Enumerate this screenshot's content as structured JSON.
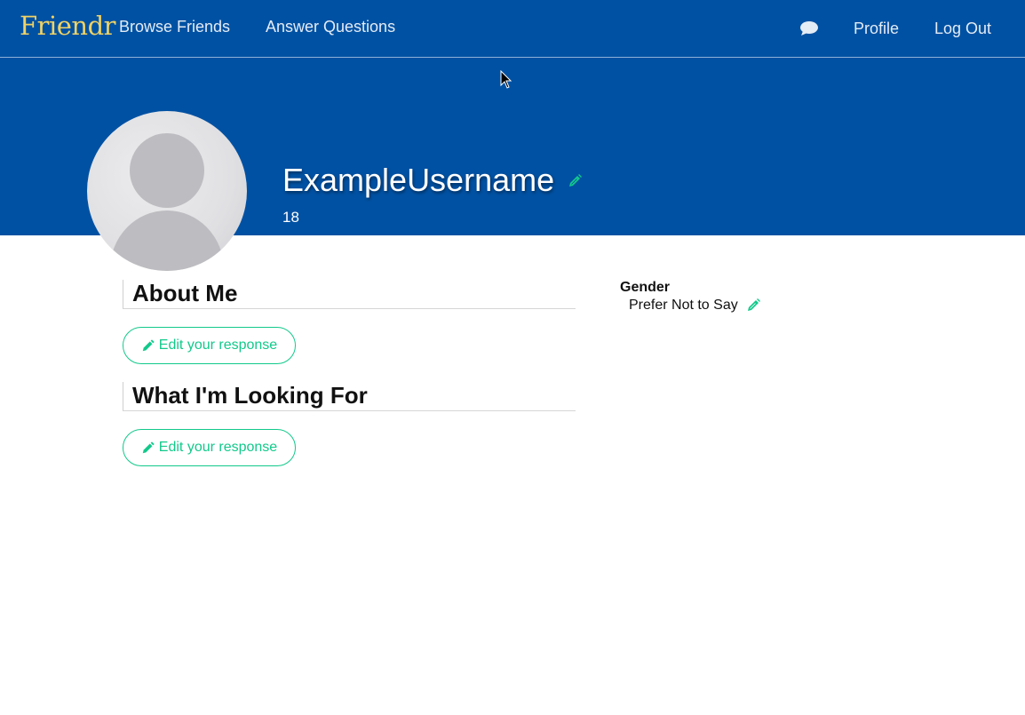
{
  "nav": {
    "brand": "Friendr",
    "browse": "Browse Friends",
    "answer": "Answer Questions",
    "profile": "Profile",
    "logout": "Log Out"
  },
  "profile": {
    "username": "ExampleUsername",
    "age": "18"
  },
  "sections": {
    "about_title": "About Me",
    "looking_title": "What I'm Looking For",
    "edit_label": "Edit your response"
  },
  "details": {
    "gender_label": "Gender",
    "gender_value": "Prefer Not to Say"
  },
  "colors": {
    "header_blue": "#0051a3",
    "brand_gold": "#f0d264",
    "accent_green": "#12c98b"
  },
  "icons": [
    "chat-icon",
    "pencil-icon",
    "avatar-placeholder",
    "mouse-cursor"
  ]
}
